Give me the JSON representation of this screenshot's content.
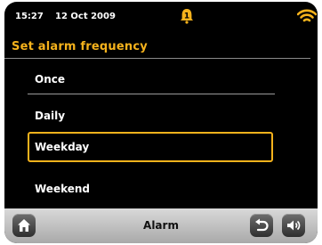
{
  "status": {
    "time": "15:27",
    "date": "12 Oct  2009",
    "alarm_badge": "1",
    "wifi_icon": "wifi-icon"
  },
  "screen": {
    "title": "Set alarm frequency"
  },
  "options": [
    {
      "label": "Once"
    },
    {
      "label": "Daily"
    },
    {
      "label": "Weekday",
      "selected": true
    },
    {
      "label": "Weekend"
    }
  ],
  "bottom": {
    "label": "Alarm",
    "home_icon": "home-icon",
    "back_icon": "back-icon",
    "volume_icon": "volume-icon"
  },
  "colors": {
    "accent": "#f5b21c",
    "background": "#000000"
  }
}
